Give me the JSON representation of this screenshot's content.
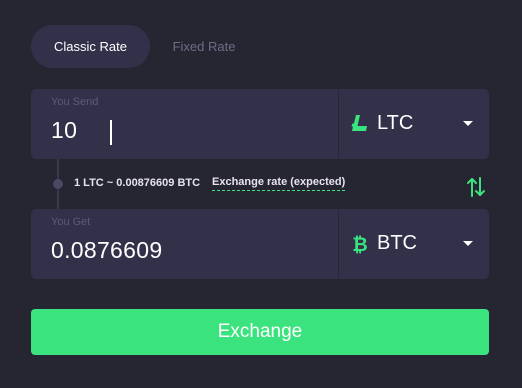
{
  "tabs": {
    "classic": "Classic Rate",
    "fixed": "Fixed Rate"
  },
  "send": {
    "label": "You Send",
    "amount": "10",
    "currency": "LTC",
    "icon": "litecoin-icon"
  },
  "rate": {
    "text": "1 LTC ~ 0.00876609 BTC",
    "link": "Exchange rate (expected)"
  },
  "get": {
    "label": "You Get",
    "amount": "0.0876609",
    "currency": "BTC",
    "icon": "bitcoin-icon"
  },
  "button": {
    "label": "Exchange"
  },
  "colors": {
    "background": "#262532",
    "panel": "#33314a",
    "accent": "#3be37f"
  }
}
